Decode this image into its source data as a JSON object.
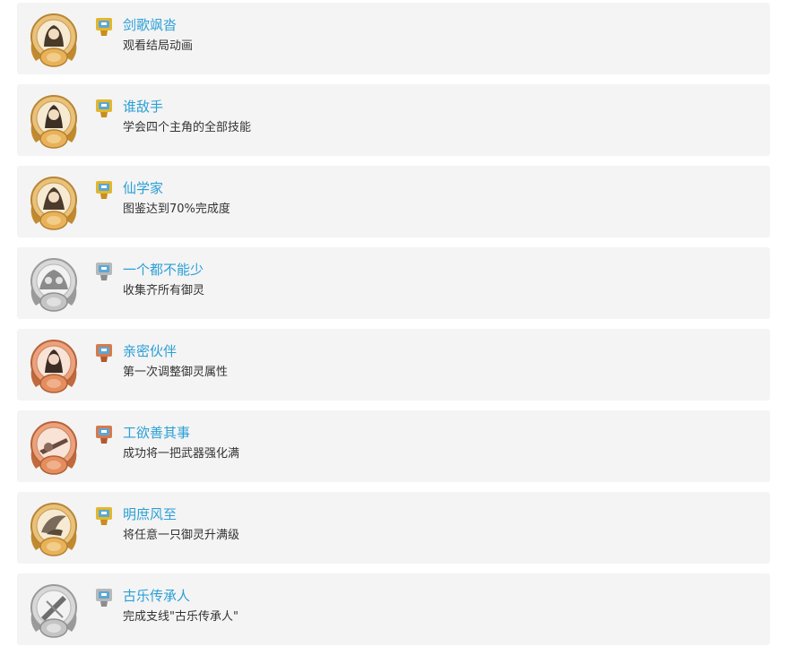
{
  "achievements": [
    {
      "title": "剑歌飒沓",
      "desc": "观看结局动画",
      "medal": "gold",
      "icon": "gold-trophy-icon",
      "color": "#d9a13a"
    },
    {
      "title": "谁敌手",
      "desc": "学会四个主角的全部技能",
      "medal": "gold",
      "icon": "gold-trophy-icon",
      "color": "#d9a13a"
    },
    {
      "title": "仙学家",
      "desc": "图鉴达到70%完成度",
      "medal": "gold",
      "icon": "gold-trophy-icon",
      "color": "#d9a13a"
    },
    {
      "title": "一个都不能少",
      "desc": "收集齐所有御灵",
      "medal": "silver",
      "icon": "silver-trophy-icon",
      "color": "#a9a9a9"
    },
    {
      "title": "亲密伙伴",
      "desc": "第一次调整御灵属性",
      "medal": "bronze",
      "icon": "bronze-trophy-icon",
      "color": "#d9794b"
    },
    {
      "title": "工欲善其事",
      "desc": "成功将一把武器强化满",
      "medal": "bronze",
      "icon": "bronze-trophy-icon",
      "color": "#d9794b"
    },
    {
      "title": "明庶风至",
      "desc": "将任意一只御灵升满级",
      "medal": "gold",
      "icon": "gold-trophy-icon",
      "color": "#d9a13a"
    },
    {
      "title": "古乐传承人",
      "desc": "完成支线\"古乐传承人\"",
      "medal": "silver",
      "icon": "silver-trophy-icon",
      "color": "#a9a9a9"
    }
  ]
}
